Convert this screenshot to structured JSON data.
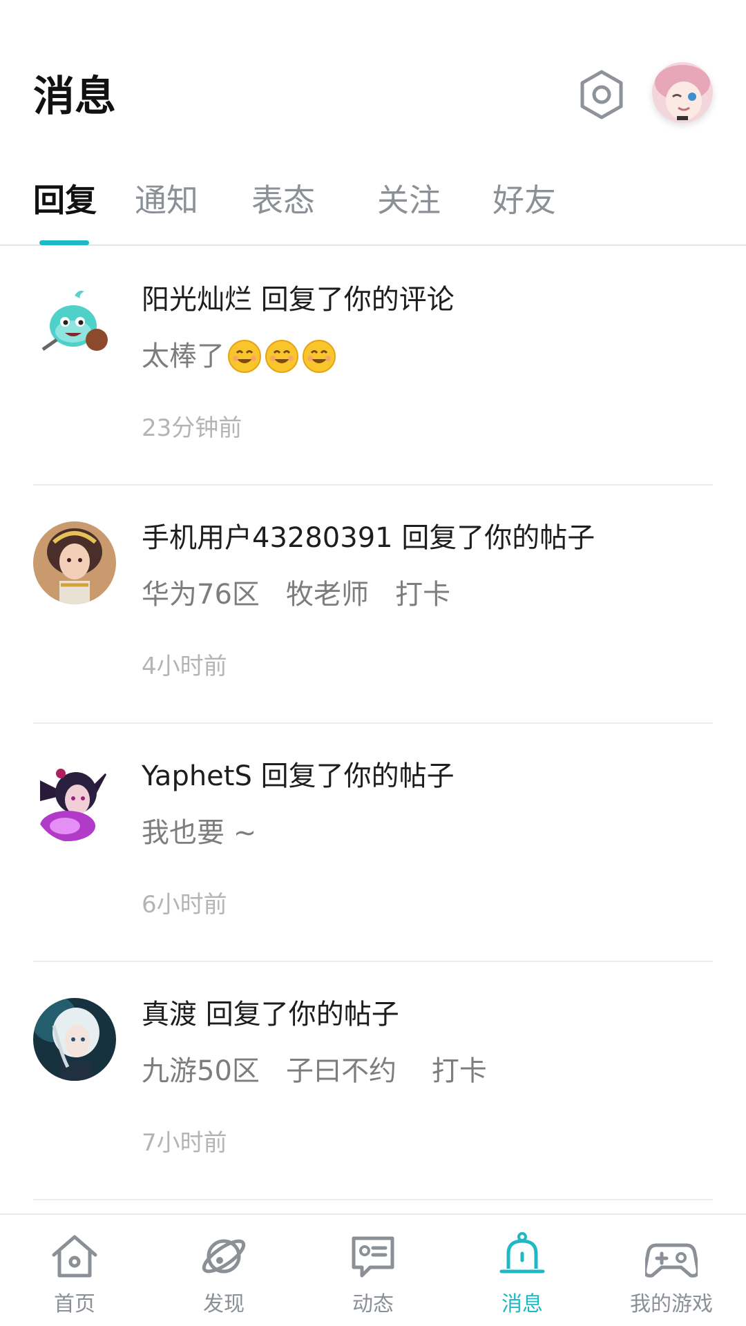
{
  "header": {
    "title": "消息",
    "settings_icon": "settings-hexagon-icon",
    "avatar_icon": "user-avatar"
  },
  "tabs": [
    {
      "label": "回复",
      "active": true
    },
    {
      "label": "通知",
      "active": false
    },
    {
      "label": "表态",
      "active": false
    },
    {
      "label": "关注",
      "active": false
    },
    {
      "label": "好友",
      "active": false
    }
  ],
  "accent_color": "#20b8c4",
  "messages": [
    {
      "user": "阳光灿烂",
      "action": "回复了你的评论",
      "content": "太棒了",
      "emojis": 3,
      "time": "23分钟前"
    },
    {
      "user": "手机用户43280391",
      "action": "回复了你的帖子",
      "content": "华为76区   牧老师   打卡",
      "emojis": 0,
      "time": "4小时前"
    },
    {
      "user": "YaphetS",
      "action": "回复了你的帖子",
      "content": "我也要 ~",
      "emojis": 0,
      "time": "6小时前"
    },
    {
      "user": "真渡",
      "action": "回复了你的帖子",
      "content": "九游50区   子曰不约    打卡",
      "emojis": 0,
      "time": "7小时前"
    }
  ],
  "bottom_nav": [
    {
      "label": "首页",
      "icon": "home-icon",
      "active": false
    },
    {
      "label": "发现",
      "icon": "discover-planet-icon",
      "active": false
    },
    {
      "label": "动态",
      "icon": "feed-card-icon",
      "active": false
    },
    {
      "label": "消息",
      "icon": "bell-icon",
      "active": true
    },
    {
      "label": "我的游戏",
      "icon": "gamepad-icon",
      "active": false
    }
  ]
}
